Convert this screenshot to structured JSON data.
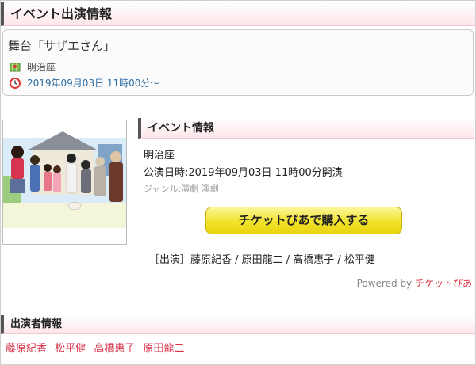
{
  "header": {
    "title": "イベント出演情報"
  },
  "event": {
    "title": "舞台「サザエさん」",
    "venue": "明治座",
    "datetime": "2019年09月03日 11時00分〜"
  },
  "info": {
    "heading": "イベント情報",
    "venue": "明治座",
    "performance_date": "公演日時:2019年09月03日 11時00分開演",
    "genre": "ジャンル:演劇 演劇",
    "buy_button": "チケットぴあで購入する",
    "cast_line": "［出演］藤原紀香 / 原田龍二 / 高橋惠子 / 松平健",
    "powered_by": "Powered by ",
    "powered_brand": "チケットぴあ"
  },
  "cast": {
    "heading": "出演者情報",
    "names": [
      "藤原紀香",
      "松平健",
      "高橋惠子",
      "原田龍二"
    ]
  },
  "colors": {
    "accent": "#d9334a",
    "button": "#f2e22a",
    "date_link": "#2e6da4"
  }
}
